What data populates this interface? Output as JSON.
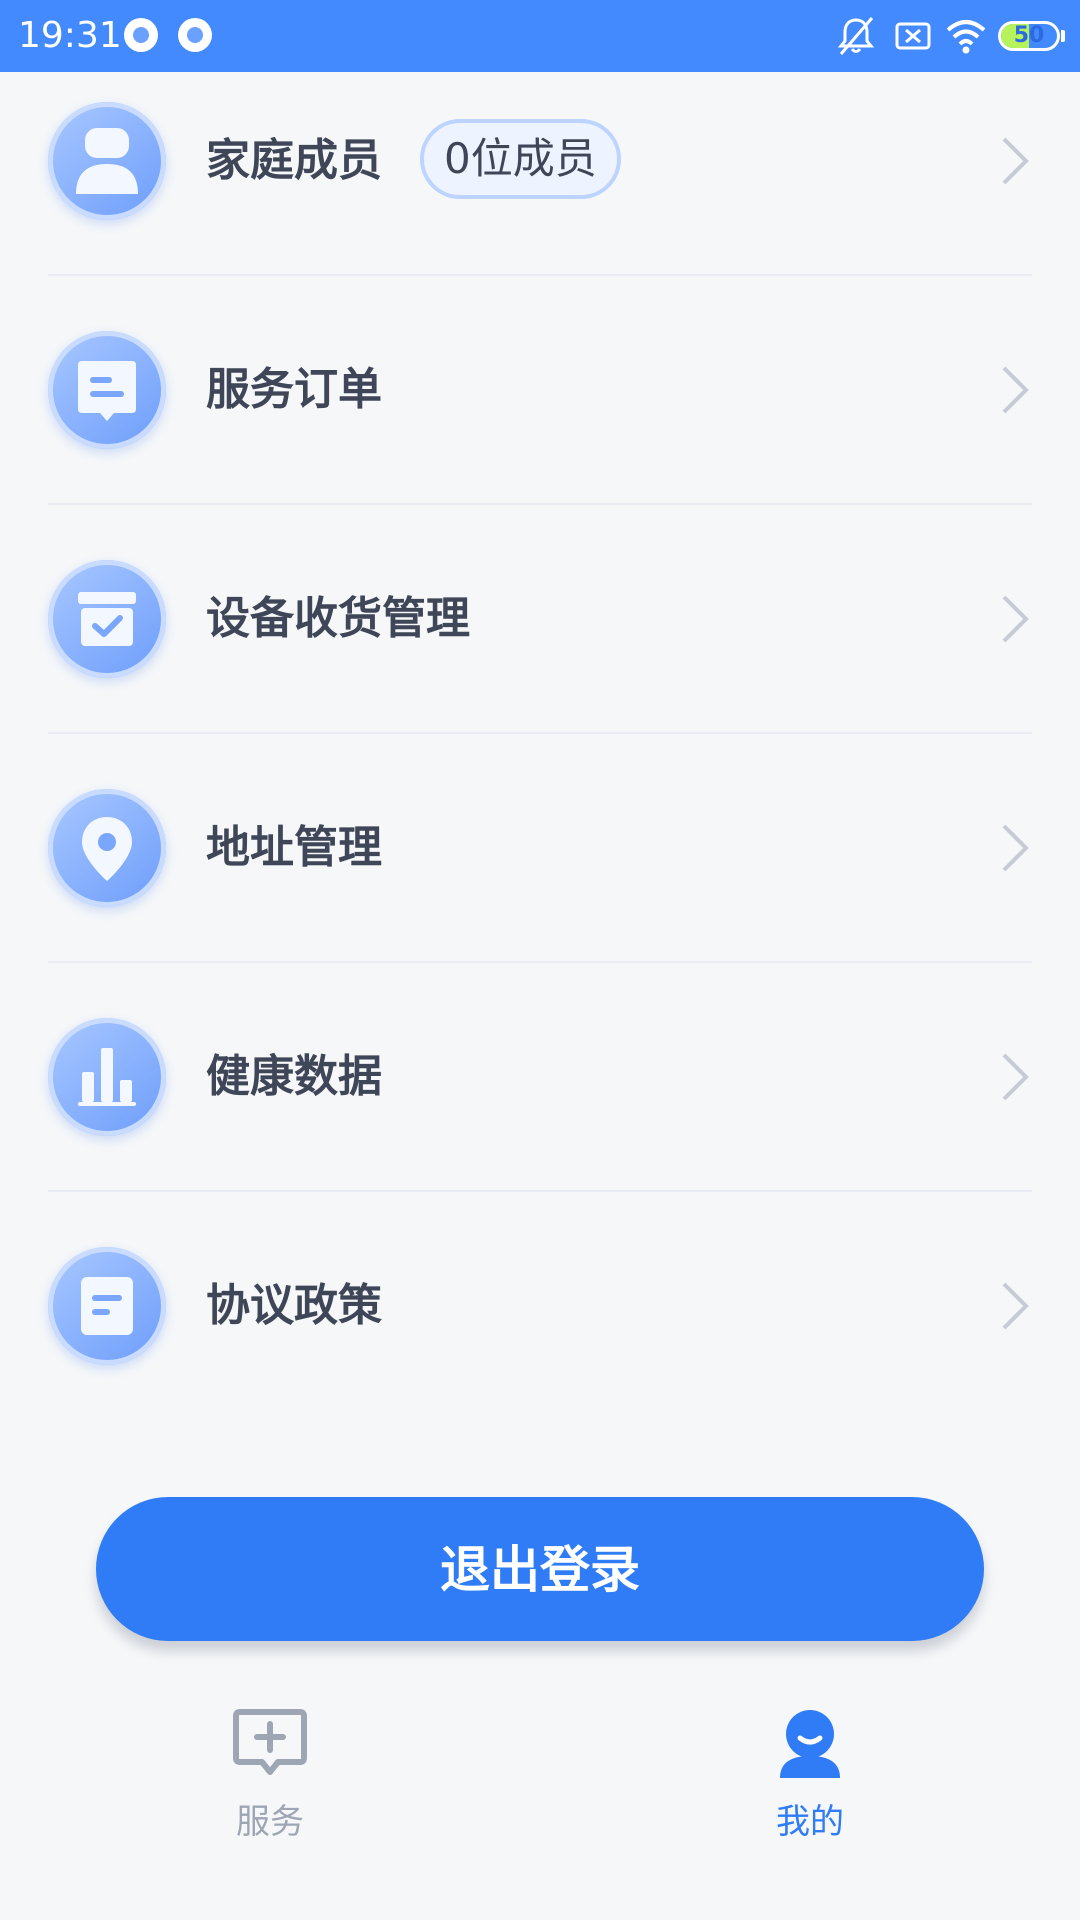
{
  "status_bar": {
    "time": "19:31",
    "battery_level": "50",
    "battery_fraction": 0.5,
    "icons": [
      "notification-dot-icon",
      "notification-dot-icon",
      "bell-muted-icon",
      "no-sim-icon",
      "wifi-icon",
      "battery-icon"
    ]
  },
  "menu": {
    "items": [
      {
        "label": "家庭成员",
        "badge": "0位成员",
        "icon": "family-member-icon"
      },
      {
        "label": "服务订单",
        "icon": "service-order-icon"
      },
      {
        "label": "设备收货管理",
        "icon": "device-delivery-icon"
      },
      {
        "label": "地址管理",
        "icon": "location-pin-icon"
      },
      {
        "label": "健康数据",
        "icon": "bar-chart-icon"
      },
      {
        "label": "协议政策",
        "icon": "document-icon"
      }
    ]
  },
  "logout": {
    "label": "退出登录"
  },
  "bottom_nav": {
    "tabs": [
      {
        "label": "服务",
        "icon": "chat-plus-icon",
        "active": false
      },
      {
        "label": "我的",
        "icon": "user-profile-icon",
        "active": true
      }
    ]
  },
  "colors": {
    "primary": "#2f7cf6",
    "status_bar": "#448aff",
    "active_tab": "#2f7cf6",
    "inactive_tab": "#9ea6b4",
    "label_text": "#3f4657"
  }
}
